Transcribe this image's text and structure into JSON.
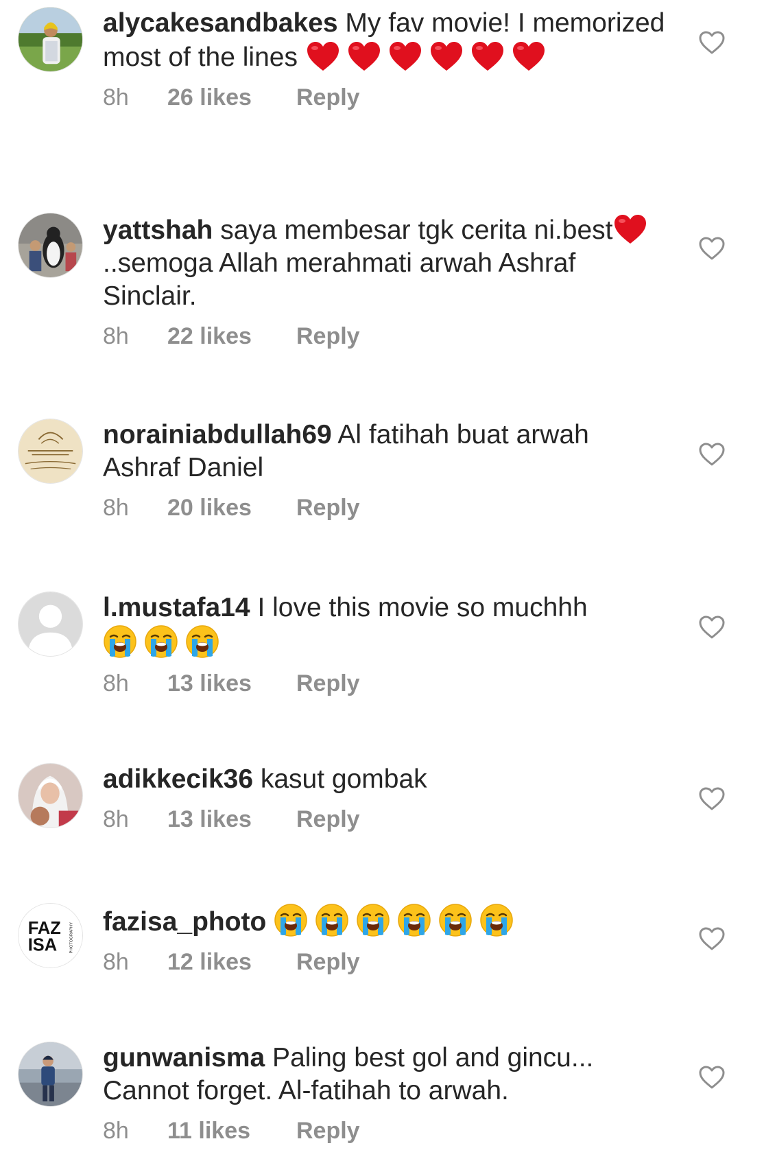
{
  "comments": [
    {
      "username": "alycakesandbakes",
      "text_before": " My fav movie! I memorized most of the lines ",
      "emoji": "❤️❤️❤️❤️❤️❤️",
      "time": "8h",
      "likes": "26 likes",
      "reply": "Reply"
    },
    {
      "username": "yattshah",
      "text_before": " saya membesar tgk cerita ni.best",
      "emoji": "❤️",
      "text_after": "..semoga Allah merahmati arwah Ashraf Sinclair.",
      "time": "8h",
      "likes": "22 likes",
      "reply": "Reply"
    },
    {
      "username": "norainiabdullah69",
      "text_before": " Al fatihah buat arwah Ashraf Daniel",
      "time": "8h",
      "likes": "20 likes",
      "reply": "Reply"
    },
    {
      "username": "l.mustafa14",
      "text_before": " I love this movie so muchhh",
      "emoji": "😭😭😭",
      "time": "8h",
      "likes": "13 likes",
      "reply": "Reply"
    },
    {
      "username": "adikkecik36",
      "text_before": " kasut gombak",
      "time": "8h",
      "likes": "13 likes",
      "reply": "Reply"
    },
    {
      "username": "fazisa_photo",
      "text_before": " ",
      "emoji": "😭😭😭😭😭😭",
      "avatar_logo": [
        "FAZ",
        "ISA",
        "PHOTOGRAPHY"
      ],
      "time": "8h",
      "likes": "12 likes",
      "reply": "Reply"
    },
    {
      "username": "gunwanisma",
      "text_before": " Paling best gol and gincu... Cannot forget. Al-fatihah to arwah.",
      "time": "8h",
      "likes": "11 likes",
      "reply": "Reply"
    }
  ],
  "icons": {
    "like": "heart-outline-icon",
    "heart_emoji": "red-heart-emoji",
    "cry_emoji": "loudly-crying-face-emoji"
  },
  "colors": {
    "text": "#262626",
    "meta": "#8e8e8e",
    "heart": "#e0101e",
    "like_outline": "#8e8e8e"
  }
}
